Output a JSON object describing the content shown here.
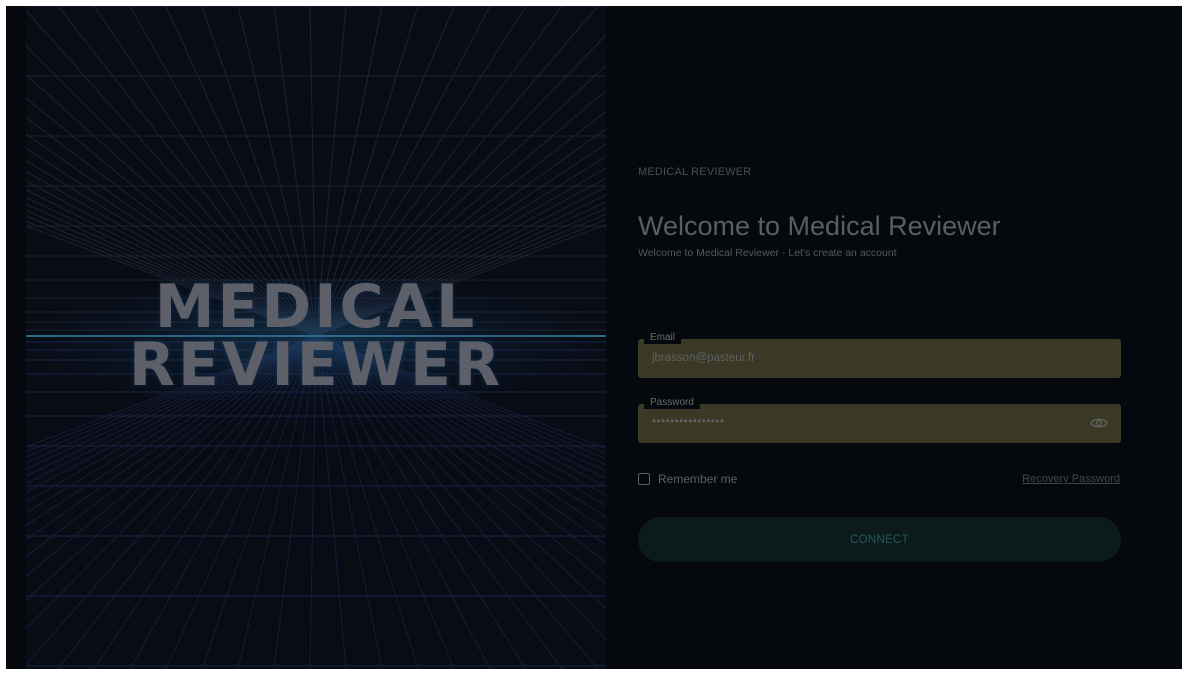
{
  "hero": {
    "logo_line1": "MEDICAL",
    "logo_line2": "REVIEWER"
  },
  "form": {
    "brand": "MEDICAL REVIEWER",
    "title": "Welcome to Medical Reviewer",
    "subtitle": "Welcome to Medical Reviewer - Let's create an account",
    "email_label": "Email",
    "email_value": "jbrasson@pasteur.fr",
    "password_label": "Password",
    "password_value": "••••••••••••••••",
    "password_icon": "eye-icon",
    "remember_label": "Remember me",
    "remember_checked": false,
    "recovery_label": "Recovery Password",
    "connect_label": "CONNECT"
  },
  "colors": {
    "background": "#05080c",
    "field_fill": "#3a3925",
    "button_fill": "#0c1a1c",
    "button_text": "#1f5a5e"
  }
}
